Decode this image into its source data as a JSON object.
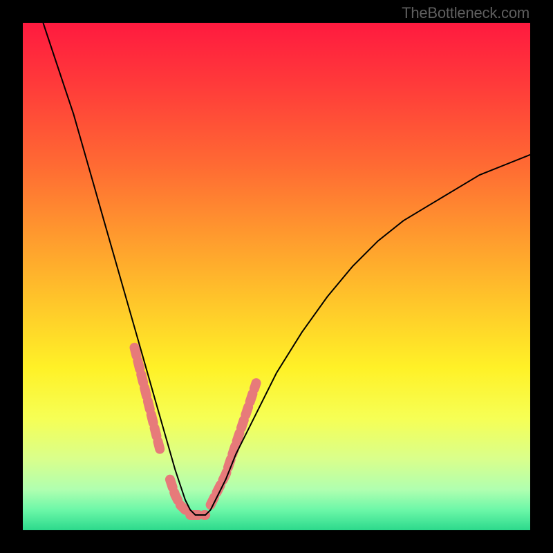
{
  "watermark": "TheBottleneck.com",
  "chart_data": {
    "type": "line",
    "title": "",
    "xlabel": "",
    "ylabel": "",
    "xlim": [
      0,
      100
    ],
    "ylim": [
      0,
      100
    ],
    "background": {
      "type": "vertical_gradient",
      "stops": [
        {
          "pos": 0.0,
          "color": "#ff1a3f"
        },
        {
          "pos": 0.12,
          "color": "#ff3a3a"
        },
        {
          "pos": 0.28,
          "color": "#ff6a33"
        },
        {
          "pos": 0.42,
          "color": "#ff9a2e"
        },
        {
          "pos": 0.55,
          "color": "#ffc62a"
        },
        {
          "pos": 0.68,
          "color": "#fff127"
        },
        {
          "pos": 0.78,
          "color": "#f6ff55"
        },
        {
          "pos": 0.86,
          "color": "#d9ff8c"
        },
        {
          "pos": 0.92,
          "color": "#b0ffb0"
        },
        {
          "pos": 0.96,
          "color": "#6cf7a8"
        },
        {
          "pos": 1.0,
          "color": "#2cd98c"
        }
      ]
    },
    "series": [
      {
        "name": "bottleneck-curve",
        "color": "#000000",
        "x": [
          4,
          6,
          8,
          10,
          12,
          14,
          16,
          18,
          20,
          22,
          24,
          26,
          28,
          30,
          31,
          32,
          33,
          34,
          35,
          36,
          37,
          38,
          40,
          42,
          45,
          50,
          55,
          60,
          65,
          70,
          75,
          80,
          85,
          90,
          95,
          100
        ],
        "y": [
          100,
          94,
          88,
          82,
          75,
          68,
          61,
          54,
          47,
          40,
          33,
          26,
          19,
          12,
          9,
          6,
          4,
          3,
          3,
          3,
          4,
          6,
          10,
          15,
          21,
          31,
          39,
          46,
          52,
          57,
          61,
          64,
          67,
          70,
          72,
          74
        ]
      }
    ],
    "markers": [
      {
        "name": "blob-markers",
        "color": "#e77a7a",
        "segments": [
          {
            "x": [
              22,
              23,
              24,
              25,
              26,
              27
            ],
            "y": [
              36,
              32,
              28,
              24,
              20,
              16
            ]
          },
          {
            "x": [
              29,
              30,
              31,
              32
            ],
            "y": [
              10,
              7,
              5,
              4
            ]
          },
          {
            "x": [
              33,
              34,
              35,
              36
            ],
            "y": [
              3,
              3,
              3,
              3
            ]
          },
          {
            "x": [
              37,
              38,
              39,
              40,
              41,
              42,
              43,
              44,
              45,
              46
            ],
            "y": [
              5,
              7,
              9,
              11,
              14,
              17,
              20,
              23,
              26,
              29
            ]
          }
        ]
      }
    ]
  }
}
